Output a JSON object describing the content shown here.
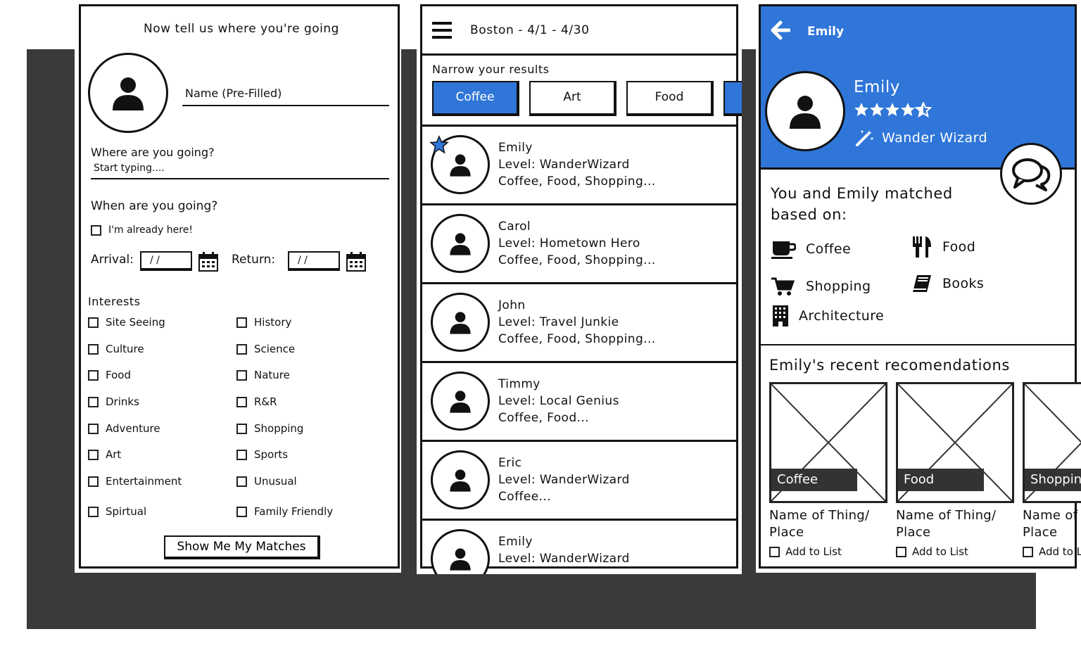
{
  "panel1": {
    "title": "Now tell us where you're going",
    "name_field": "Name (Pre-Filled)",
    "where_label": "Where are you going?",
    "where_placeholder": "Start typing....",
    "when_label": "When are you going?",
    "already_here": "I'm already here!",
    "arrival_label": "Arrival:",
    "return_label": "Return:",
    "date_value": "/ /",
    "interests_label": "Interests",
    "interests_left": [
      "Site Seeing",
      "Culture",
      "Food",
      "Drinks",
      "Adventure",
      "Art",
      "Entertainment",
      "Spirtual"
    ],
    "interests_right": [
      "History",
      "Science",
      "Nature",
      "R&R",
      "Shopping",
      "Sports",
      "Unusual",
      "Family Friendly"
    ],
    "button": "Show Me My Matches"
  },
  "panel2": {
    "header": "Boston - 4/1 - 4/30",
    "narrow_label": "Narrow your results",
    "filters": [
      "Coffee",
      "Art",
      "Food"
    ],
    "results": [
      {
        "name": "Emily",
        "level": "Level: WanderWizard",
        "interests": "Coffee, Food, Shopping..."
      },
      {
        "name": "Carol",
        "level": "Level: Hometown Hero",
        "interests": "Coffee, Food, Shopping..."
      },
      {
        "name": "John",
        "level": "Level: Travel Junkie",
        "interests": "Coffee, Food, Shopping..."
      },
      {
        "name": "Timmy",
        "level": "Level: Local Genius",
        "interests": "Coffee, Food..."
      },
      {
        "name": "Eric",
        "level": "Level: WanderWizard",
        "interests": "Coffee..."
      },
      {
        "name": "Emily",
        "level": "Level: WanderWizard",
        "interests": ""
      }
    ]
  },
  "panel3": {
    "back_title": "Emily",
    "profile_name": "Emily",
    "rating": 4.5,
    "level": "Wander Wizard",
    "matched_line1": "You and Emily matched",
    "matched_line2": "based on:",
    "matched": [
      {
        "label": "Coffee",
        "icon": "coffee-cup-icon"
      },
      {
        "label": "Food",
        "icon": "fork-knife-icon"
      },
      {
        "label": "Shopping",
        "icon": "shopping-cart-icon"
      },
      {
        "label": "Books",
        "icon": "book-icon"
      },
      {
        "label": "Architecture",
        "icon": "building-icon"
      }
    ],
    "recent_title": "Emily's recent recomendations",
    "cards": [
      {
        "tag": "Coffee",
        "name1": "Name of Thing/",
        "name2": "Place",
        "add": "Add to List"
      },
      {
        "tag": "Food",
        "name1": "Name of Thing/",
        "name2": "Place",
        "add": "Add to List"
      },
      {
        "tag": "Shopping",
        "name1": "Name of Thing/",
        "name2": "Place",
        "add": "Add to List"
      }
    ]
  },
  "colors": {
    "accent": "#2f76d8",
    "backdrop": "#3a3a3a",
    "ink": "#111111"
  }
}
